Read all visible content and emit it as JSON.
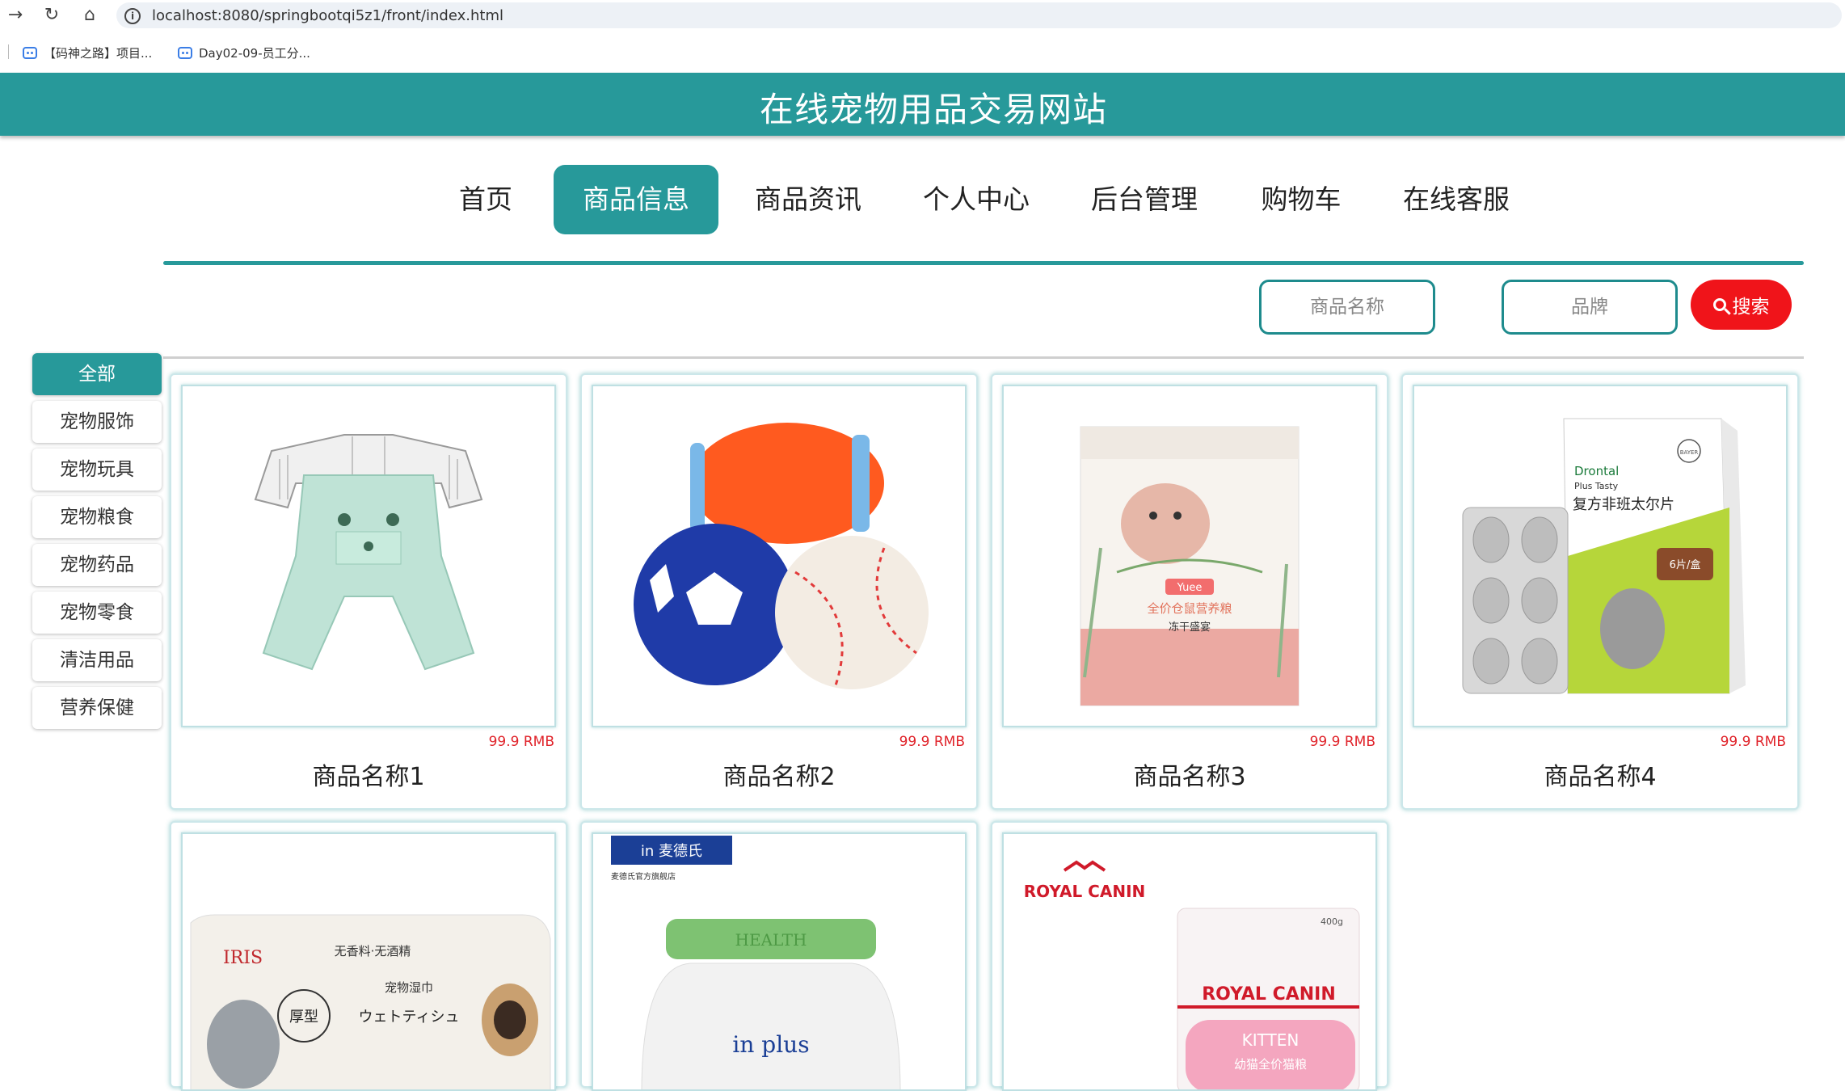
{
  "browser": {
    "url": "localhost:8080/springbootqi5z1/front/index.html",
    "bookmarks": [
      "【码神之路】项目...",
      "Day02-09-员工分..."
    ]
  },
  "site": {
    "title": "在线宠物用品交易网站"
  },
  "nav": {
    "items": [
      "首页",
      "商品信息",
      "商品资讯",
      "个人中心",
      "后台管理",
      "购物车",
      "在线客服"
    ],
    "active": "商品信息"
  },
  "search": {
    "name_placeholder": "商品名称",
    "brand_placeholder": "品牌",
    "button_label": "搜索"
  },
  "categories": [
    "全部",
    "宠物服饰",
    "宠物玩具",
    "宠物粮食",
    "宠物药品",
    "宠物零食",
    "清洁用品",
    "营养保健"
  ],
  "active_category": "全部",
  "products": [
    {
      "name": "商品名称1",
      "price": "99.9 RMB",
      "image": "pet-clothes-overalls"
    },
    {
      "name": "商品名称2",
      "price": "99.9 RMB",
      "image": "pet-toy-balls"
    },
    {
      "name": "商品名称3",
      "price": "99.9 RMB",
      "image": "pet-food-bag"
    },
    {
      "name": "商品名称4",
      "price": "99.9 RMB",
      "image": "pet-medicine-box"
    },
    {
      "name": "",
      "price": "",
      "image": "pet-wipes-pack"
    },
    {
      "name": "",
      "price": "",
      "image": "pet-supplement-jar"
    },
    {
      "name": "",
      "price": "",
      "image": "kitten-food-bag"
    }
  ],
  "image_text": {
    "drontal_brand": "Drontal",
    "drontal_sub": "Plus Tasty",
    "drontal_cn": "复方非班太尔片",
    "drontal_qty": "6片/盒",
    "bayer": "BAYER",
    "food_brand": "Yuee",
    "food_line1": "全价仓鼠营养粮",
    "food_line2": "冻干盛宴",
    "wipes_brand": "IRIS",
    "wipes_line1": "无香料·无酒精",
    "wipes_line2": "宠物湿巾",
    "wipes_line3": "ウェトティシュ",
    "wipes_badge": "厚型",
    "maidesi_logo": "in 麦德氏",
    "maidesi_sub": "麦德氏官方旗舰店",
    "maidesi_health": "HEALTH",
    "maidesi_plus": "in plus",
    "royal_canin": "ROYAL CANIN",
    "kitten": "KITTEN",
    "kitten_cn": "幼猫全价猫粮",
    "weight": "400g"
  },
  "colors": {
    "primary": "#27999a",
    "accent": "#f0141a",
    "price": "#e0232a"
  }
}
